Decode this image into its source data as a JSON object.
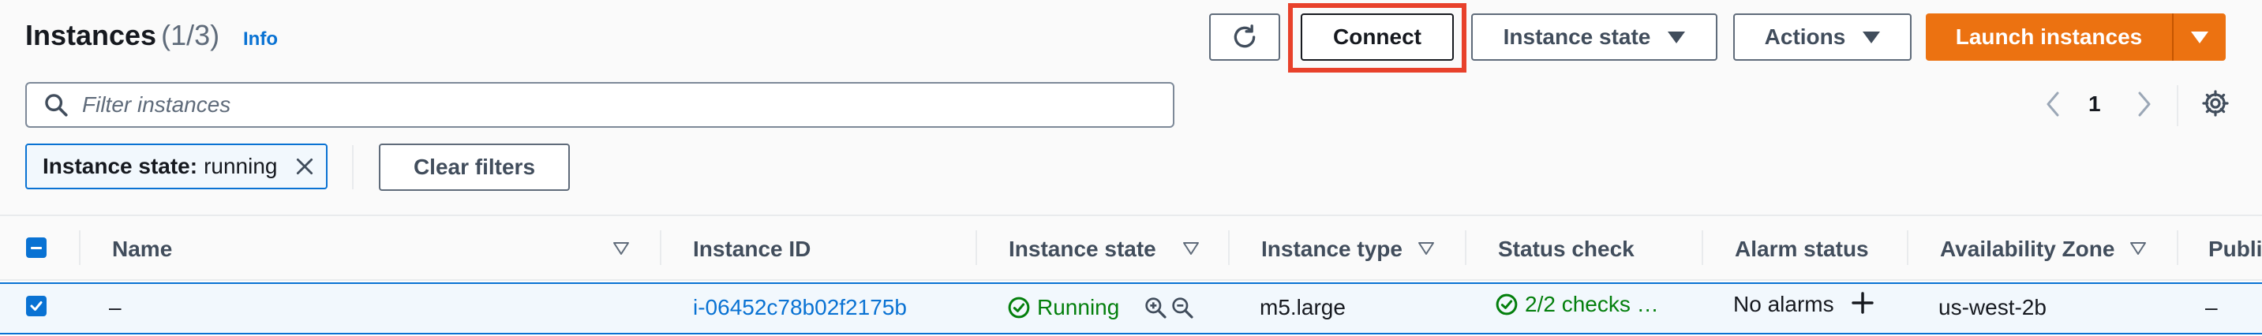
{
  "header": {
    "title": "Instances",
    "count": "(1/3)",
    "info_label": "Info"
  },
  "toolbar": {
    "refresh_icon": "refresh-icon",
    "connect_label": "Connect",
    "instance_state_label": "Instance state",
    "actions_label": "Actions",
    "launch_label": "Launch instances",
    "highlight_color": "#e8412b",
    "launch_color": "#ec7211"
  },
  "search": {
    "placeholder": "Filter instances",
    "value": ""
  },
  "pagination": {
    "current_page": "1"
  },
  "filters": {
    "token_key": "Instance state:",
    "token_value": "running",
    "clear_label": "Clear filters"
  },
  "table": {
    "columns": [
      "Name",
      "Instance ID",
      "Instance state",
      "Instance type",
      "Status check",
      "Alarm status",
      "Availability Zone",
      "Publi"
    ],
    "rows": [
      {
        "selected": true,
        "name": "–",
        "instance_id": "i-06452c78b02f2175b",
        "instance_state": "Running",
        "instance_type": "m5.large",
        "status_check": "2/2 checks …",
        "alarm_status": "No alarms",
        "availability_zone": "us-west-2b",
        "public": "–"
      }
    ]
  }
}
